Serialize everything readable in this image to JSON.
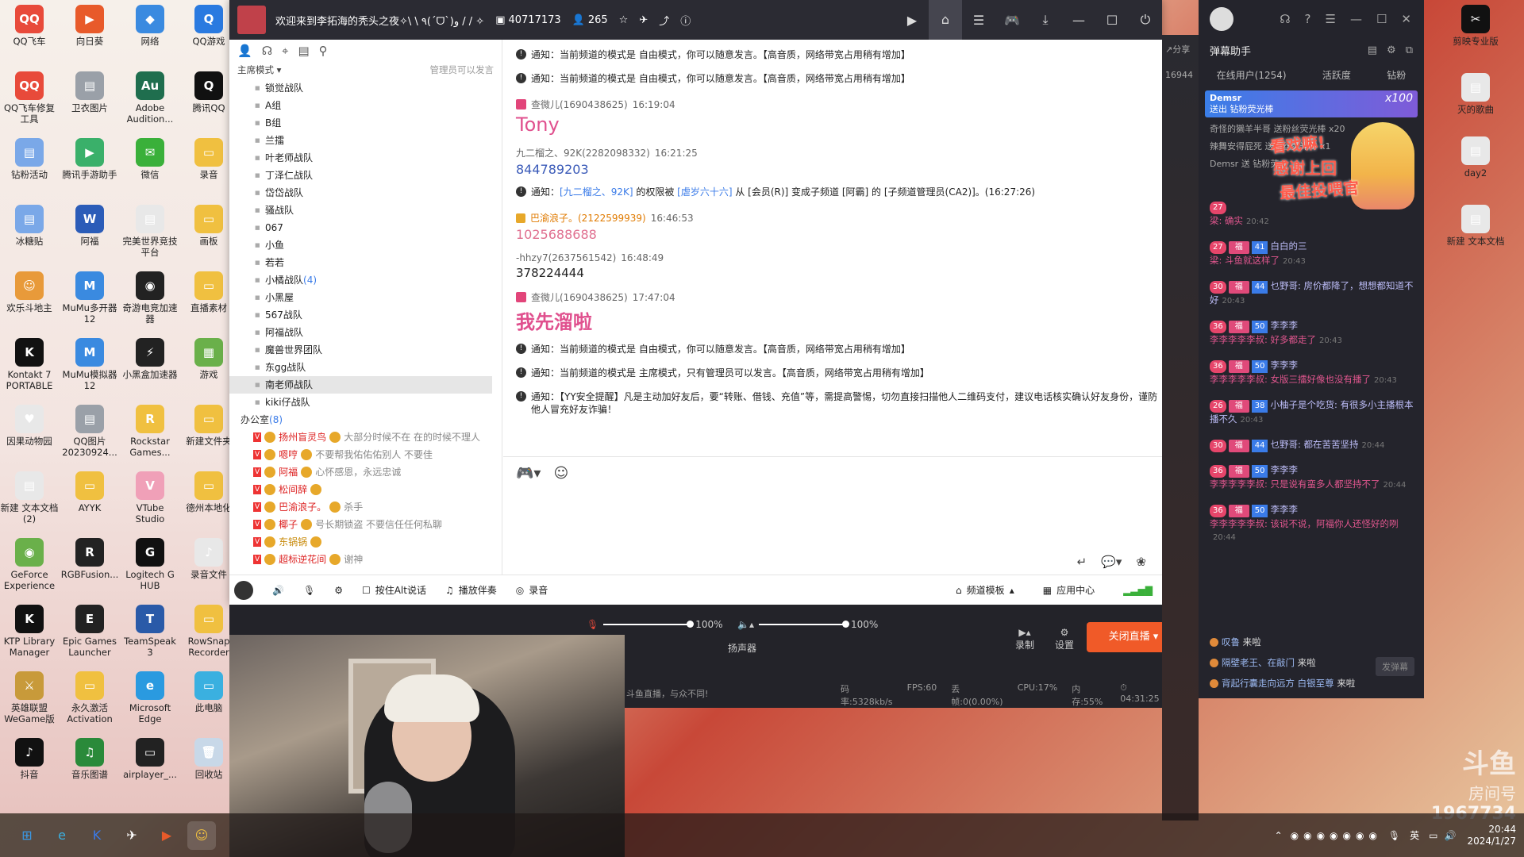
{
  "desktop_icons_left": [
    {
      "label": "QQ飞车",
      "color": "#e84a3a",
      "glyph": "QQ"
    },
    {
      "label": "向日葵",
      "color": "#e85a2a",
      "glyph": "▶"
    },
    {
      "label": "网络",
      "color": "#3a8ae0",
      "glyph": "◆"
    },
    {
      "label": "QQ游戏",
      "color": "#2a7ae0",
      "glyph": "Q"
    },
    {
      "label": "QQ飞车修复工具",
      "color": "#e84a3a",
      "glyph": "QQ"
    },
    {
      "label": "卫衣图片",
      "color": "#9aa0a8",
      "glyph": "▤"
    },
    {
      "label": "Adobe Audition...",
      "color": "#1f6e4e",
      "glyph": "Au"
    },
    {
      "label": "腾讯QQ",
      "color": "#111111",
      "glyph": "Q"
    },
    {
      "label": "钻粉活动",
      "color": "#7aa8e8",
      "glyph": "▤"
    },
    {
      "label": "腾讯手游助手",
      "color": "#3ab06a",
      "glyph": "▶"
    },
    {
      "label": "微信",
      "color": "#3ab03a",
      "glyph": "✉"
    },
    {
      "label": "录音",
      "color": "#f0c040",
      "glyph": "▭"
    },
    {
      "label": "冰糖贴",
      "color": "#7aa8e8",
      "glyph": "▤"
    },
    {
      "label": "阿福",
      "color": "#2b5cb8",
      "glyph": "W"
    },
    {
      "label": "完美世界竞技平台",
      "color": "#e8e8e8",
      "glyph": "▤"
    },
    {
      "label": "画板",
      "color": "#f0c040",
      "glyph": "▭"
    },
    {
      "label": "欢乐斗地主",
      "color": "#e89a3a",
      "glyph": "☺"
    },
    {
      "label": "MuMu多开器12",
      "color": "#3a8ae0",
      "glyph": "M"
    },
    {
      "label": "奇游电竞加速器",
      "color": "#222222",
      "glyph": "◉"
    },
    {
      "label": "直播素材",
      "color": "#f0c040",
      "glyph": "▭"
    },
    {
      "label": "Kontakt 7 PORTABLE",
      "color": "#111111",
      "glyph": "K"
    },
    {
      "label": "MuMu模拟器12",
      "color": "#3a8ae0",
      "glyph": "M"
    },
    {
      "label": "小黑盒加速器",
      "color": "#222222",
      "glyph": "⚡"
    },
    {
      "label": "游戏",
      "color": "#6ab04a",
      "glyph": "▦"
    },
    {
      "label": "因果动物园",
      "color": "#e8e8e8",
      "glyph": "♥"
    },
    {
      "label": "QQ图片20230924...",
      "color": "#9aa0a8",
      "glyph": "▤"
    },
    {
      "label": "Rockstar Games...",
      "color": "#f0c040",
      "glyph": "R"
    },
    {
      "label": "新建文件夹",
      "color": "#f0c040",
      "glyph": "▭"
    },
    {
      "label": "新建 文本文档 (2)",
      "color": "#e8e8e8",
      "glyph": "▤"
    },
    {
      "label": "AYYK",
      "color": "#f0c040",
      "glyph": "▭"
    },
    {
      "label": "VTube Studio",
      "color": "#f0a0b8",
      "glyph": "V"
    },
    {
      "label": "德州本地化",
      "color": "#f0c040",
      "glyph": "▭"
    },
    {
      "label": "GeForce Experience",
      "color": "#6ab04a",
      "glyph": "◉"
    },
    {
      "label": "RGBFusion...",
      "color": "#222222",
      "glyph": "R"
    },
    {
      "label": "Logitech G HUB",
      "color": "#111111",
      "glyph": "G"
    },
    {
      "label": "录音文件",
      "color": "#e8e8e8",
      "glyph": "♪"
    },
    {
      "label": "KTP Library Manager",
      "color": "#111111",
      "glyph": "K"
    },
    {
      "label": "Epic Games Launcher",
      "color": "#222222",
      "glyph": "E"
    },
    {
      "label": "TeamSpeak 3",
      "color": "#2a5aa8",
      "glyph": "T"
    },
    {
      "label": "RowSnap Recorder",
      "color": "#f0c040",
      "glyph": "▭"
    },
    {
      "label": "英雄联盟WeGame版",
      "color": "#c89a3a",
      "glyph": "⚔"
    },
    {
      "label": "永久激活Activation",
      "color": "#f0c040",
      "glyph": "▭"
    },
    {
      "label": "Microsoft Edge",
      "color": "#2a9ae0",
      "glyph": "e"
    },
    {
      "label": "此电脑",
      "color": "#3ab0e0",
      "glyph": "▭"
    },
    {
      "label": "抖音",
      "color": "#111111",
      "glyph": "♪"
    },
    {
      "label": "音乐图谱",
      "color": "#2a8a3a",
      "glyph": "♫"
    },
    {
      "label": "airplayer_...",
      "color": "#222222",
      "glyph": "▭"
    },
    {
      "label": "回收站",
      "color": "#c8d8e8",
      "glyph": "🗑"
    }
  ],
  "desktop_icons_right": [
    {
      "label": "剪映专业版",
      "color": "#111111",
      "glyph": "✂"
    },
    {
      "label": "灭的歌曲",
      "color": "#e8e8e8",
      "glyph": "▤"
    },
    {
      "label": "day2",
      "color": "#e8e8e8",
      "glyph": "▤"
    },
    {
      "label": "新建 文本文档",
      "color": "#e8e8e8",
      "glyph": "▤"
    }
  ],
  "yy": {
    "title": "欢迎来到李拓海的秃头之夜✧\\ \\ ٩(ˊᗜˋ)و / / ✧",
    "channel_id": "40717173",
    "online": "265",
    "mode_label": "主席模式",
    "mode_hint": "管理员可以发言",
    "channels": [
      {
        "name": "锁觉战队",
        "count": ""
      },
      {
        "name": "A组",
        "count": ""
      },
      {
        "name": "B组",
        "count": ""
      },
      {
        "name": "兰擂",
        "count": ""
      },
      {
        "name": "叶老师战队",
        "count": ""
      },
      {
        "name": "丁泽仁战队",
        "count": ""
      },
      {
        "name": "岱岱战队",
        "count": ""
      },
      {
        "name": "骚战队",
        "count": ""
      },
      {
        "name": "067",
        "count": ""
      },
      {
        "name": "小鱼",
        "count": ""
      },
      {
        "name": "若若",
        "count": ""
      },
      {
        "name": "小橘战队",
        "count": "(4)"
      },
      {
        "name": "小黑屋",
        "count": ""
      },
      {
        "name": "567战队",
        "count": ""
      },
      {
        "name": "阿福战队",
        "count": ""
      },
      {
        "name": "魔兽世界团队",
        "count": ""
      },
      {
        "name": "东gg战队",
        "count": ""
      },
      {
        "name": "南老师战队",
        "count": "",
        "selected": true
      },
      {
        "name": "kiki仔战队",
        "count": ""
      }
    ],
    "office": {
      "name": "办公室",
      "count": "(8)"
    },
    "users": [
      {
        "name": "扬州盲灵鸟",
        "sig": "大部分时候不在 在的时候不理人",
        "gold": false
      },
      {
        "name": "嗯哼",
        "sig": "不要帮我佑佑佑别人 不要佳",
        "gold": false
      },
      {
        "name": "阿福",
        "sig": "心怀感恩，永远忠诚",
        "gold": false
      },
      {
        "name": "松间辞",
        "sig": "",
        "gold": false
      },
      {
        "name": "巴渝浪子。",
        "sig": "杀手",
        "gold": false
      },
      {
        "name": "椰子",
        "sig": "号长期锁盗 不要信任任何私聊",
        "gold": false
      },
      {
        "name": "东锅锅",
        "sig": "",
        "gold": true
      },
      {
        "name": "超标逆花间",
        "sig": "谢神",
        "gold": false
      }
    ],
    "messages": [
      {
        "kind": "notice",
        "text": "通知：当前频道的模式是 自由模式，你可以随意发言。【高音质，网络带宽占用稍有增加】"
      },
      {
        "kind": "notice",
        "text": "通知：当前频道的模式是 自由模式，你可以随意发言。【高音质，网络带宽占用稍有增加】"
      },
      {
        "kind": "chat",
        "sender": "查微儿(1690438625)",
        "time": "16:19:04",
        "body": "Tony",
        "style": "pink-large",
        "gift": true
      },
      {
        "kind": "chat",
        "sender": "九二榴之、92K(2282098332)",
        "time": "16:21:25",
        "body": "844789203",
        "style": "blue",
        "gift": false
      },
      {
        "kind": "notice-perm",
        "pre": "通知：",
        "user1": "[九二榴之、92K]",
        "mid": " 的权限被 ",
        "user2": "[虐岁六十六]",
        "post": " 从 [会员(R)] 变成子频道 [阿霸] 的 [子频道管理员(CA2)]。(16:27:26)"
      },
      {
        "kind": "chat",
        "sender": "巴渝浪子。(2122599939)",
        "time": "16:46:53",
        "body": "1025688688",
        "style": "pink",
        "gift": false,
        "gold": true
      },
      {
        "kind": "chat",
        "sender": "-hhzy7(2637561542)",
        "time": "16:48:49",
        "body": "378224444",
        "style": "dark",
        "gift": false
      },
      {
        "kind": "chat",
        "sender": "查微儿(1690438625)",
        "time": "17:47:04",
        "body": "我先溜啦",
        "style": "pink-xl",
        "gift": true
      },
      {
        "kind": "notice",
        "text": "通知：当前频道的模式是 自由模式，你可以随意发言。【高音质，网络带宽占用稍有增加】"
      },
      {
        "kind": "notice",
        "text": "通知：当前频道的模式是 主席模式，只有管理员可以发言。【高音质，网络带宽占用稍有增加】"
      },
      {
        "kind": "notice",
        "text": "通知：【YY安全提醒】凡是主动加好友后，要“转账、借钱、充值”等，需提高警惕，切勿直接扫描他人二维码支付，建议电话核实确认好友身份，谨防他人冒充好友诈骗！"
      }
    ],
    "bottom": {
      "alt_talk": "按住Alt说话",
      "play_accompany": "播放伴奏",
      "record": "录音",
      "channel_template": "频道模板",
      "app_center": "应用中心"
    }
  },
  "obs": {
    "mic_percent": "100%",
    "speaker_percent": "100%",
    "speaker_label": "扬声器",
    "record_label": "录制",
    "settings_label": "设置",
    "live_button": "关闭直播",
    "slogan": "斗鱼直播，与众不同!",
    "bitrate": "码率:5328kb/s",
    "fps": "FPS:60",
    "dropped": "丢帧:0(0.00%)",
    "cpu": "CPU:17%",
    "memory": "内存:55%",
    "duration": "04:31:25"
  },
  "danmu": {
    "title": "弹幕助手",
    "tabs": [
      "在线用户(1254)",
      "活跃度",
      "钻粉"
    ],
    "gift_banner_name": "Demsr",
    "gift_banner_sub": "送出  钻粉荧光棒",
    "gift_banner_count": "x100",
    "gift_lines": [
      "奇怪的獭羊半哥 送粉丝荧光棒 x20",
      "辣舞安得屁死 送粉丝荧光棒 x1",
      "Demsr 送 钻粉荧..."
    ],
    "overlay_texts": [
      "看戏嘛!",
      "感谢上回",
      "最佳投喂官"
    ],
    "messages": [
      {
        "level": "27",
        "fu": "",
        "gl": "",
        "name": "",
        "text": "梁: 确实",
        "ts": "20:42"
      },
      {
        "level": "27",
        "fu": "福",
        "gl": "41",
        "name": "白白的三",
        "text": "梁: 斗鱼就这样了",
        "ts": "20:43"
      },
      {
        "level": "30",
        "fu": "福",
        "gl": "44",
        "name": "乜野哥: 房价都降了，想想都知道不好",
        "text": "",
        "ts": "20:43"
      },
      {
        "level": "36",
        "fu": "福",
        "gl": "50",
        "name": "李李李",
        "text": "李李李李李叔: 好多都走了",
        "ts": "20:43"
      },
      {
        "level": "36",
        "fu": "福",
        "gl": "50",
        "name": "李李李",
        "text": "李李李李李叔: 女版三擂好像也没有播了",
        "ts": "20:43"
      },
      {
        "level": "26",
        "fu": "福",
        "gl": "38",
        "name": "小柚子是个吃货: 有很多小主播根本播不久",
        "text": "",
        "ts": "20:43"
      },
      {
        "level": "30",
        "fu": "福",
        "gl": "44",
        "name": "乜野哥: 都在苦苦坚持",
        "text": "",
        "ts": "20:44"
      },
      {
        "level": "36",
        "fu": "福",
        "gl": "50",
        "name": "李李李",
        "text": "李李李李李叔: 只是说有蛮多人都坚持不了",
        "ts": "20:44"
      },
      {
        "level": "36",
        "fu": "福",
        "gl": "50",
        "name": "李李李",
        "text": "李李李李李叔: 该说不说，阿福你人还怪好的咧",
        "ts": "20:44"
      }
    ],
    "enters": [
      {
        "name": "叹鲁",
        "action": "来啦"
      },
      {
        "name": "隔壁老王、在敲门",
        "action": "来啦"
      },
      {
        "name": "背起行囊走向远方 白银至尊",
        "action": "来啦"
      }
    ],
    "send_label": "发弹幕"
  },
  "watermark": {
    "room_label": "房间号",
    "room_number": "1967734"
  },
  "taskbar": {
    "ime": "英",
    "time": "20:44",
    "date": "2024/1/27"
  }
}
